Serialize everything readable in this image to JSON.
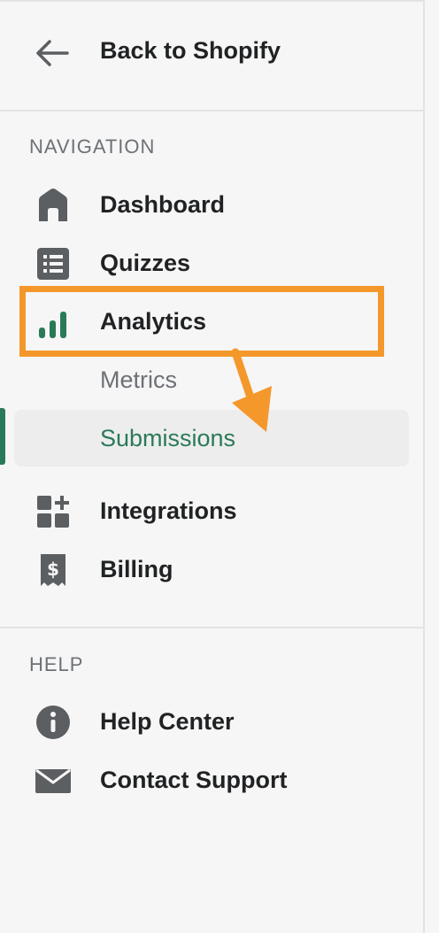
{
  "back": {
    "label": "Back to Shopify",
    "icon": "arrow-left-icon"
  },
  "sections": {
    "navigation": {
      "title": "NAVIGATION",
      "items": [
        {
          "label": "Dashboard",
          "icon": "home-icon"
        },
        {
          "label": "Quizzes",
          "icon": "list-icon"
        },
        {
          "label": "Analytics",
          "icon": "bar-chart-icon"
        }
      ],
      "sub_items": [
        {
          "label": "Metrics"
        },
        {
          "label": "Submissions",
          "active": true
        }
      ],
      "more_items": [
        {
          "label": "Integrations",
          "icon": "apps-add-icon"
        },
        {
          "label": "Billing",
          "icon": "receipt-dollar-icon"
        }
      ]
    },
    "help": {
      "title": "HELP",
      "items": [
        {
          "label": "Help Center",
          "icon": "info-icon"
        },
        {
          "label": "Contact Support",
          "icon": "mail-icon"
        }
      ]
    }
  },
  "colors": {
    "accent_green": "#2b7a57",
    "annotation_orange": "#f4982b",
    "icon_gray": "#5c5f62"
  }
}
